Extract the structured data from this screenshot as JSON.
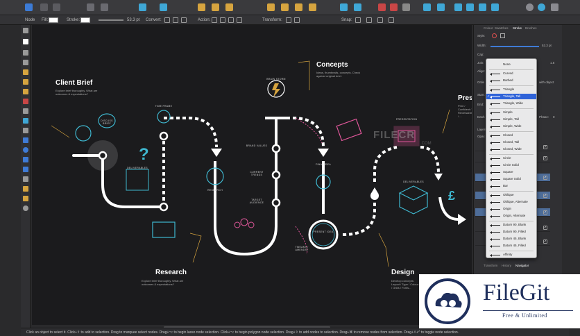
{
  "context_bar": {
    "node_label": "Node",
    "fill_label": "Fill:",
    "stroke_label": "Stroke:",
    "stroke_width": "53.3 pt",
    "convert_label": "Convert:",
    "action_label": "Action:",
    "transform_label": "Transform:",
    "snap_label": "Snap:"
  },
  "canvas": {
    "watermark": "FILECR",
    "watermark_sub": ".COM",
    "sections": {
      "client_brief": {
        "title": "Client Brief",
        "desc": "Explore brief thoroughly. What are outcomes & expectations?"
      },
      "concepts": {
        "title": "Concepts",
        "desc": "Ideas, thumbnails, concepts. Check against original brief."
      },
      "research": {
        "title": "Research",
        "desc": "Explore brief thoroughly. What are outcomes & expectations?"
      },
      "design": {
        "title": "Design",
        "desc": "Develop concepts: Layout / Type / Colour / Grids / Fonts..."
      },
      "presentation_head": {
        "title": "Pres",
        "desc": "Print / Confident / Reviewable / ..."
      }
    },
    "labels": {
      "time_frame": "TIME FRAME",
      "discuss_brief": "DISCUSS BRIEF",
      "deliverables": "DELIVERABLES",
      "research": "RESEARCH",
      "brain_storm": "BRAIN STORM",
      "brand_values": "BRAND VALUES",
      "current_trends": "CURRENT TRENDS",
      "target_audience": "TARGET AUDIENCE",
      "final_idea": "FINAL IDEA",
      "present_idea": "PRESENT IDEA",
      "tweaks_amends": "TWEAKS / AMENDS?",
      "presentation": "PRESENTATION",
      "deliverables2": "DELIVERABLES"
    }
  },
  "panel": {
    "tabs": [
      "Colour",
      "Swatches",
      "Stroke",
      "Brushes"
    ],
    "active_tab": "Stroke",
    "style_label": "Style:",
    "width_label": "Width:",
    "width_value": "53.3 pt",
    "cap_label": "Cap:",
    "join_label": "Join:",
    "join_value": "1.5",
    "align_label": "Align:",
    "order_label": "Orde",
    "order_right": "with object",
    "start_label": "Start:",
    "end_label": "End:",
    "dash_label": "Dash",
    "phase_label": "Phase:",
    "phase_value": "0",
    "layers_label": "Layers",
    "opacity_label": "Opac",
    "bottom_tabs": [
      "Transform",
      "History",
      "Navigator"
    ],
    "active_bottom_tab": "Navigator",
    "zoom_label": "Zoom:"
  },
  "arrowhead_menu": {
    "items": [
      {
        "label": "None",
        "checked": false,
        "highlighted": false
      },
      {
        "label": "Curved",
        "checked": false,
        "highlighted": false
      },
      {
        "label": "Barbed",
        "checked": false,
        "highlighted": false
      },
      {
        "label": "Triangle",
        "checked": false,
        "highlighted": false
      },
      {
        "label": "Triangle, Tall",
        "checked": true,
        "highlighted": true
      },
      {
        "label": "Triangle, Wide",
        "checked": false,
        "highlighted": false
      },
      {
        "label": "Simple",
        "checked": false,
        "highlighted": false
      },
      {
        "label": "Simple, Tall",
        "checked": false,
        "highlighted": false
      },
      {
        "label": "Simple, Wide",
        "checked": false,
        "highlighted": false
      },
      {
        "label": "Closed",
        "checked": false,
        "highlighted": false
      },
      {
        "label": "Closed, Tall",
        "checked": false,
        "highlighted": false
      },
      {
        "label": "Closed, Wide",
        "checked": false,
        "highlighted": false
      },
      {
        "label": "Circle",
        "checked": false,
        "highlighted": false
      },
      {
        "label": "Circle Solid",
        "checked": false,
        "highlighted": false
      },
      {
        "label": "Square",
        "checked": false,
        "highlighted": false
      },
      {
        "label": "Square Solid",
        "checked": false,
        "highlighted": false
      },
      {
        "label": "Bar",
        "checked": false,
        "highlighted": false
      },
      {
        "label": "Oblique",
        "checked": false,
        "highlighted": false
      },
      {
        "label": "Oblique, Alternate",
        "checked": false,
        "highlighted": false
      },
      {
        "label": "Origin",
        "checked": false,
        "highlighted": false
      },
      {
        "label": "Origin, Alternate",
        "checked": false,
        "highlighted": false
      },
      {
        "label": "Datum 90, Blank",
        "checked": false,
        "highlighted": false
      },
      {
        "label": "Datum 90, Filled",
        "checked": false,
        "highlighted": false
      },
      {
        "label": "Datum 45, Blank",
        "checked": false,
        "highlighted": false
      },
      {
        "label": "Datum 45, Filled",
        "checked": false,
        "highlighted": false
      },
      {
        "label": "Affinity",
        "checked": false,
        "highlighted": false
      }
    ]
  },
  "status_bar": {
    "text": "Click an object to select it. Click+⇧ to add to selection. Drag to marquee select nodes. Drag+⌥ to begin lasso node selection. Click+⌥ to begin polygon node selection. Drag+⇧ to add nodes to selection. Drag+⌘ to remove nodes from selection. Drag+⇧+^ to toggle node selection."
  },
  "logo": {
    "name": "FileGit",
    "tagline": "Free & Unlimited"
  },
  "colors": {
    "accent_cyan": "#3fb8d0",
    "accent_pink": "#e0579a",
    "highlight_blue": "#2f63d9",
    "canvas_bg": "#1b1b1d",
    "logo_navy": "#1f2f5c"
  }
}
